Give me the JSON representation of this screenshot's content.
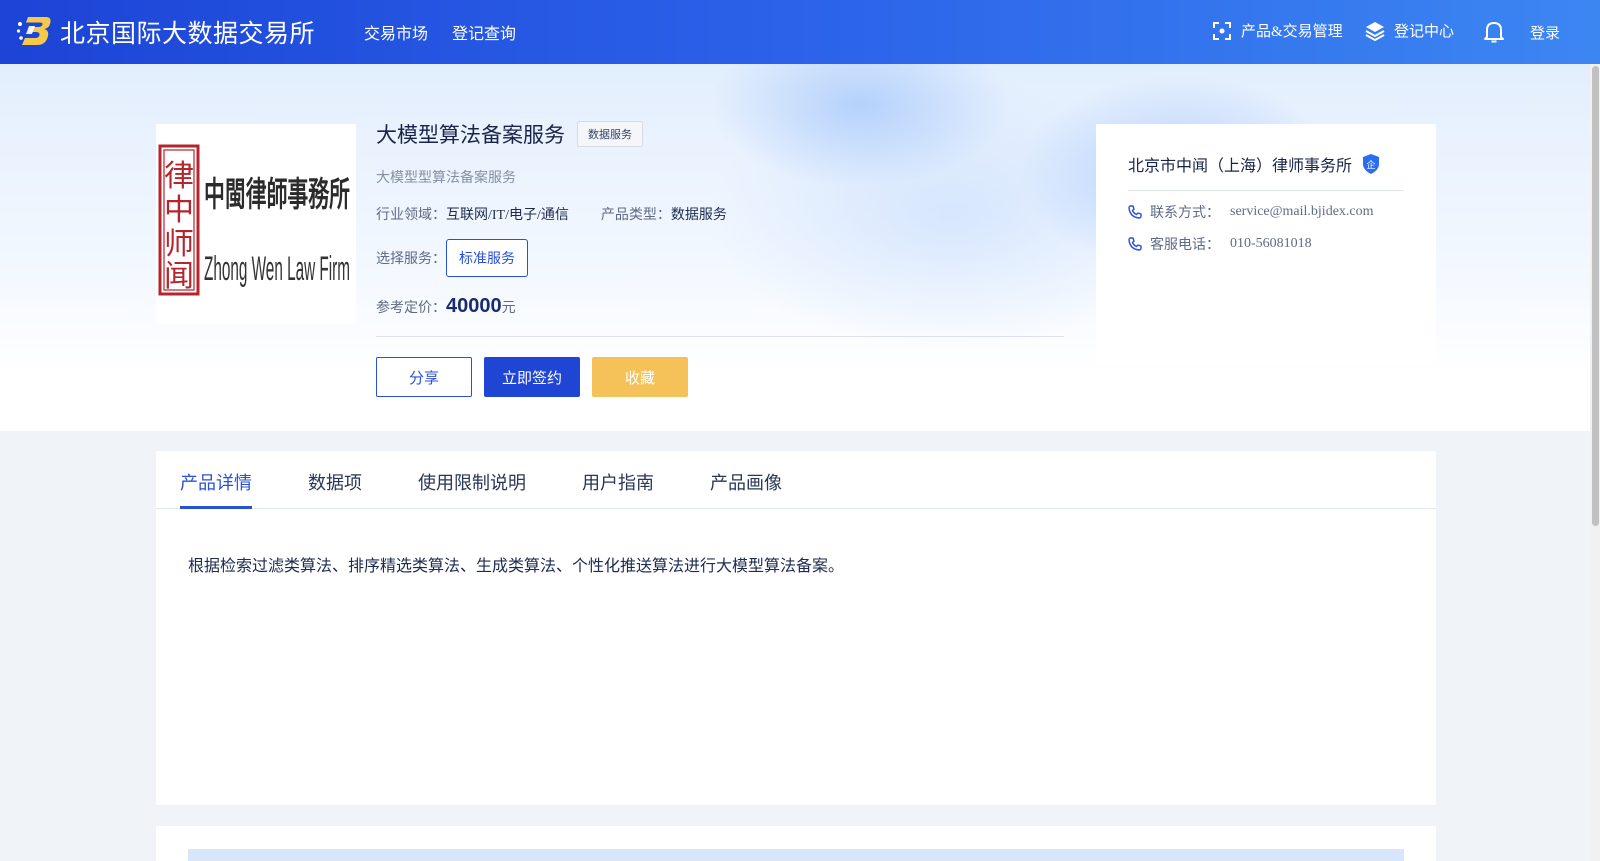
{
  "header": {
    "site_title": "北京国际大数据交易所",
    "nav": [
      "交易市场",
      "登记查询"
    ],
    "product_trade_label": "产品&交易管理",
    "registry_label": "登记中心",
    "login_label": "登录"
  },
  "product": {
    "name": "大模型算法备案服务",
    "type_tag": "数据服务",
    "subtitle": "大模型型算法备案服务",
    "industry_label": "行业领域：",
    "industry_value": "互联网/IT/电子/通信",
    "type_label": "产品类型：",
    "type_value": "数据服务",
    "select_label": "选择服务：",
    "service_option": "标准服务",
    "price_label": "参考定价：",
    "price_value": "40000",
    "price_unit": "元",
    "buttons": {
      "share": "分享",
      "sign": "立即签约",
      "favorite": "收藏"
    },
    "logo_text": {
      "seal_chars": "律中师闻",
      "cn_name": "中閩律師事務所",
      "en_name": "Zhong Wen Law Firm"
    }
  },
  "provider": {
    "name": "北京市中闻（上海）律师事务所",
    "badge_text": "企",
    "contact_label": "联系方式：",
    "contact_value": "service@mail.bjidex.com",
    "hotline_label": "客服电话：",
    "hotline_value": "010-56081018"
  },
  "tabs": [
    "产品详情",
    "数据项",
    "使用限制说明",
    "用户指南",
    "产品画像"
  ],
  "active_tab": 0,
  "description": "根据检索过滤类算法、排序精选类算法、生成类算法、个性化推送算法进行大模型算法备案。",
  "colors": {
    "header_start": "#1c44d6",
    "header_end": "#3c86f2",
    "primary": "#1f45d4",
    "favorite": "#f5c259",
    "seal_red": "#b3262d"
  }
}
